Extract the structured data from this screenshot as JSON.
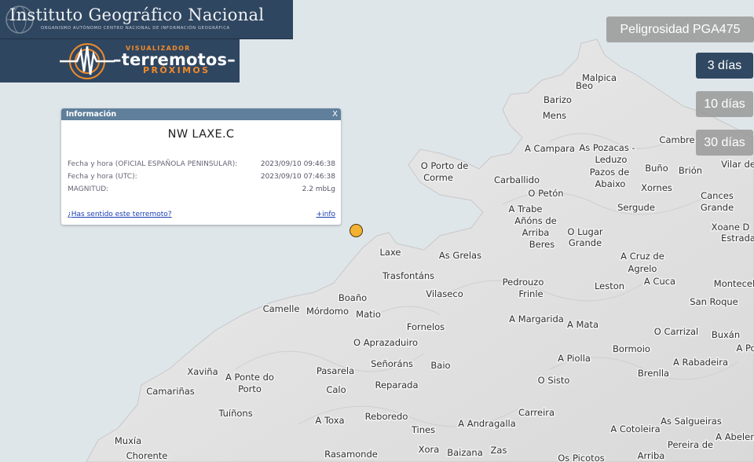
{
  "header": {
    "ign_title": "Instituto Geográfico Nacional",
    "ign_subtitle": "Organismo Autónomo Centro Nacional de Información Geográfica",
    "viz_small": "VISUALIZADOR",
    "viz_main": "terremotos",
    "viz_prox": "PRÓXIMOS"
  },
  "controls": {
    "pga_label": "Peligrosidad PGA475",
    "days_3": "3 días",
    "days_10": "10 días",
    "days_30": "30 días",
    "selected": "3 días"
  },
  "popup": {
    "header": "Información",
    "close": "X",
    "title": "NW LAXE.C",
    "local_label": "Fecha y hora (OFICIAL ESPAÑOLA PENINSULAR):",
    "local_value": "2023/09/10 09:46:38",
    "utc_label": "Fecha y hora (UTC):",
    "utc_value": "2023/09/10 07:46:38",
    "mag_label": "MAGNITUD:",
    "mag_value": "2.2 mbLg",
    "felt_link": "¿Has sentido este terremoto?",
    "more_link": "+info"
  },
  "colors": {
    "sea": "#dfe6ea",
    "land": "#e9e9e9",
    "marker": "#f4b233",
    "selected_button": "#304862"
  },
  "places": [
    "Malpica",
    "Beo",
    "Barizo",
    "Mens",
    "A Campara",
    "As Pozacas -",
    "Leduzo",
    "Pazos de",
    "Abaixo",
    "Buño",
    "Brión",
    "Cambre",
    "Vilar de",
    "O Porto de",
    "Corme",
    "Carballido",
    "O Petón",
    "Xornes",
    "Cances",
    "Grande",
    "A Trabe",
    "Añóns de",
    "Arriba",
    "Beres",
    "O Lugar",
    "Grande",
    "Sergude",
    "Xoane D",
    "Estrada",
    "Laxe",
    "As Grelas",
    "A Cruz de",
    "Agrelo",
    "Trasfontáns",
    "A Cuca",
    "Montecel",
    "Pedrouzo",
    "Frinle",
    "Leston",
    "Boaño",
    "Vilaseco",
    "San Roque",
    "Camelle",
    "Mórdomo",
    "Matio",
    "A Margarida",
    "A Mata",
    "O Carrizal",
    "Buxán",
    "Fornelos",
    "Bormoio",
    "A Po",
    "O Aprazaduiro",
    "A Piolla",
    "A Rabadeira",
    "Xaviña",
    "A Ponte do",
    "Porto",
    "Pasarela",
    "Señoráns",
    "Baio",
    "Brenlla",
    "Camariñas",
    "Calo",
    "Reparada",
    "O Sisto",
    "Tuíñons",
    "Reboredo",
    "Carreira",
    "As Salgueiras",
    "A Toxa",
    "A Andragalla",
    "A Cotoleira",
    "Tines",
    "A Abelenc",
    "Muxía",
    "Chorente",
    "Rasamonde",
    "Xora",
    "Baizana",
    "Zas",
    "Os Picotos",
    "Pereira de",
    "Arriba"
  ]
}
